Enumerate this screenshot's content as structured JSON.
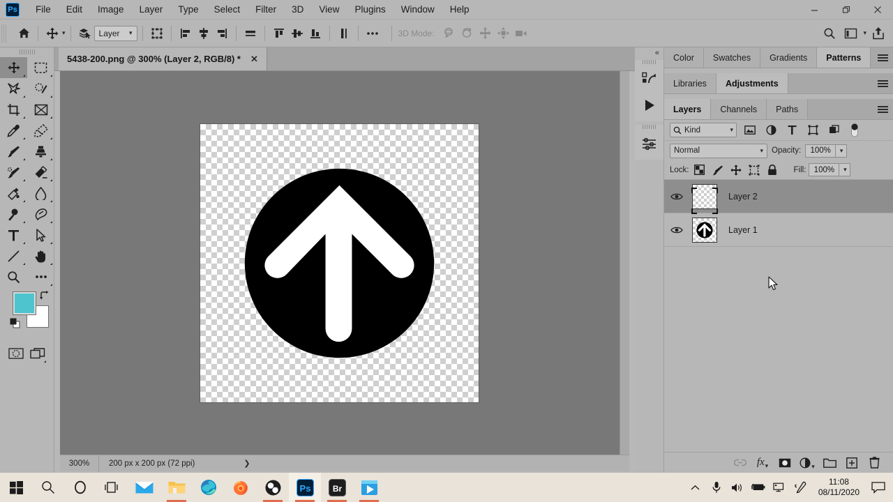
{
  "window": {
    "app_logo": "photoshop-logo",
    "menus": [
      "File",
      "Edit",
      "Image",
      "Layer",
      "Type",
      "Select",
      "Filter",
      "3D",
      "View",
      "Plugins",
      "Window",
      "Help"
    ],
    "minimize": "–",
    "maximize": "❐",
    "close": "✕"
  },
  "options_bar": {
    "home_icon": "home-icon",
    "move_tool_icon": "move-tool-icon",
    "auto_select_icon": "auto-select-layers-icon",
    "layer_select_value": "Layer",
    "transform_controls_icon": "show-transform-controls-icon",
    "align_icons": [
      "align-left-edges-icon",
      "align-horizontal-centers-icon",
      "align-right-edges-icon",
      "distribute-horizontal-icon"
    ],
    "align_icons2": [
      "align-top-edges-icon",
      "align-vertical-centers-icon",
      "align-bottom-edges-icon",
      "distribute-vertical-icon"
    ],
    "more_icon": "more-options-icon",
    "mode_3d_label": "3D Mode:",
    "mode_3d_icons": [
      "orbit-3d-icon",
      "roll-3d-icon",
      "pan-3d-icon",
      "slide-3d-icon",
      "camera-3d-icon"
    ],
    "search_icon": "search-icon",
    "workspace_icon": "arrange-documents-icon",
    "share_icon": "share-icon"
  },
  "toolbar": {
    "tools": [
      {
        "name": "move-tool",
        "active": true
      },
      {
        "name": "rectangular-marquee-tool",
        "active": false
      },
      {
        "name": "lasso-tool",
        "active": false
      },
      {
        "name": "quick-selection-tool",
        "active": false
      },
      {
        "name": "crop-tool",
        "active": false
      },
      {
        "name": "frame-tool",
        "active": false
      },
      {
        "name": "eyedropper-tool",
        "active": false
      },
      {
        "name": "spot-healing-brush-tool",
        "active": false
      },
      {
        "name": "brush-tool",
        "active": false
      },
      {
        "name": "clone-stamp-tool",
        "active": false
      },
      {
        "name": "history-brush-tool",
        "active": false
      },
      {
        "name": "eraser-tool",
        "active": false
      },
      {
        "name": "gradient-tool",
        "active": false
      },
      {
        "name": "blur-tool",
        "active": false
      },
      {
        "name": "dodge-tool",
        "active": false
      },
      {
        "name": "pen-tool",
        "active": false
      },
      {
        "name": "horizontal-type-tool",
        "active": false
      },
      {
        "name": "path-selection-tool",
        "active": false
      },
      {
        "name": "line-tool",
        "active": false
      },
      {
        "name": "hand-tool",
        "active": false
      },
      {
        "name": "zoom-tool",
        "active": false
      },
      {
        "name": "edit-toolbar-tool",
        "active": false
      }
    ],
    "foreground_color": "#4dc4ce",
    "background_color": "#ffffff",
    "swap_colors_icon": "swap-colors-icon",
    "default_colors_icon": "default-colors-icon",
    "quick_mask_icon": "quick-mask-mode-icon",
    "screen_mode_icon": "screen-mode-icon"
  },
  "document": {
    "tab_title": "5438-200.png @ 300% (Layer 2, RGB/8) *",
    "close_icon": "close-icon"
  },
  "status_bar": {
    "zoom": "300%",
    "dimensions": "200 px x 200 px (72 ppi)",
    "expand_icon": "chevron-right-icon"
  },
  "rail": {
    "collapse_icon": "«",
    "items": [
      "libraries-icon",
      "play-icon",
      "adjustments-icon"
    ]
  },
  "panels": {
    "row1": {
      "tabs": [
        "Color",
        "Swatches",
        "Gradients",
        "Patterns"
      ],
      "selected": "Patterns",
      "menu_icon": "panel-menu-icon"
    },
    "row2": {
      "tabs": [
        "Libraries",
        "Adjustments"
      ],
      "selected": "Adjustments",
      "menu_icon": "panel-menu-icon"
    },
    "row3": {
      "tabs": [
        "Layers",
        "Channels",
        "Paths"
      ],
      "selected": "Layers",
      "menu_icon": "panel-menu-icon"
    }
  },
  "layers_panel": {
    "filter_label": "Kind",
    "filter_search_icon": "search-icon",
    "filter_icons": [
      "filter-pixel-icon",
      "filter-adjustment-icon",
      "filter-type-icon",
      "filter-shape-icon",
      "filter-smart-object-icon"
    ],
    "filter_toggle_icon": "filter-toggle-icon",
    "blend_mode": "Normal",
    "opacity_label": "Opacity:",
    "opacity_value": "100%",
    "lock_label": "Lock:",
    "lock_icons": [
      "lock-transparent-pixels-icon",
      "lock-image-pixels-icon",
      "lock-position-icon",
      "lock-artboard-nesting-icon",
      "lock-all-icon"
    ],
    "fill_label": "Fill:",
    "fill_value": "100%",
    "layers": [
      {
        "name": "Layer 2",
        "visible": true,
        "selected": true,
        "thumb": "empty-transparent"
      },
      {
        "name": "Layer 1",
        "visible": true,
        "selected": false,
        "thumb": "arrow-circle"
      }
    ],
    "footer_icons": [
      "link-layers-icon",
      "add-layer-style-icon",
      "add-layer-mask-icon",
      "new-fill-adjustment-layer-icon",
      "new-group-icon",
      "new-layer-icon",
      "delete-layer-icon"
    ],
    "fx_label": "fx"
  },
  "taskbar": {
    "items": [
      {
        "name": "start-button",
        "active": false,
        "underline": false
      },
      {
        "name": "search-icon",
        "active": false,
        "underline": false
      },
      {
        "name": "cortana-icon",
        "active": false,
        "underline": false
      },
      {
        "name": "task-view-icon",
        "active": false,
        "underline": false
      },
      {
        "name": "mail-icon",
        "active": false,
        "underline": false
      },
      {
        "name": "file-explorer-icon",
        "active": false,
        "underline": true
      },
      {
        "name": "microsoft-edge-icon",
        "active": false,
        "underline": false
      },
      {
        "name": "firefox-icon",
        "active": false,
        "underline": true
      },
      {
        "name": "obs-studio-icon",
        "active": false,
        "underline": true
      },
      {
        "name": "photoshop-icon",
        "active": true,
        "underline": true
      },
      {
        "name": "bridge-icon",
        "active": false,
        "underline": true
      },
      {
        "name": "movie-maker-icon",
        "active": false,
        "underline": true
      }
    ],
    "tray": [
      "show-hidden-icons-icon",
      "microphone-icon",
      "volume-icon",
      "battery-icon",
      "network-icon",
      "pen-icon"
    ],
    "clock_time": "11:08",
    "clock_date": "08/11/2020",
    "notifications_icon": "notifications-icon"
  }
}
